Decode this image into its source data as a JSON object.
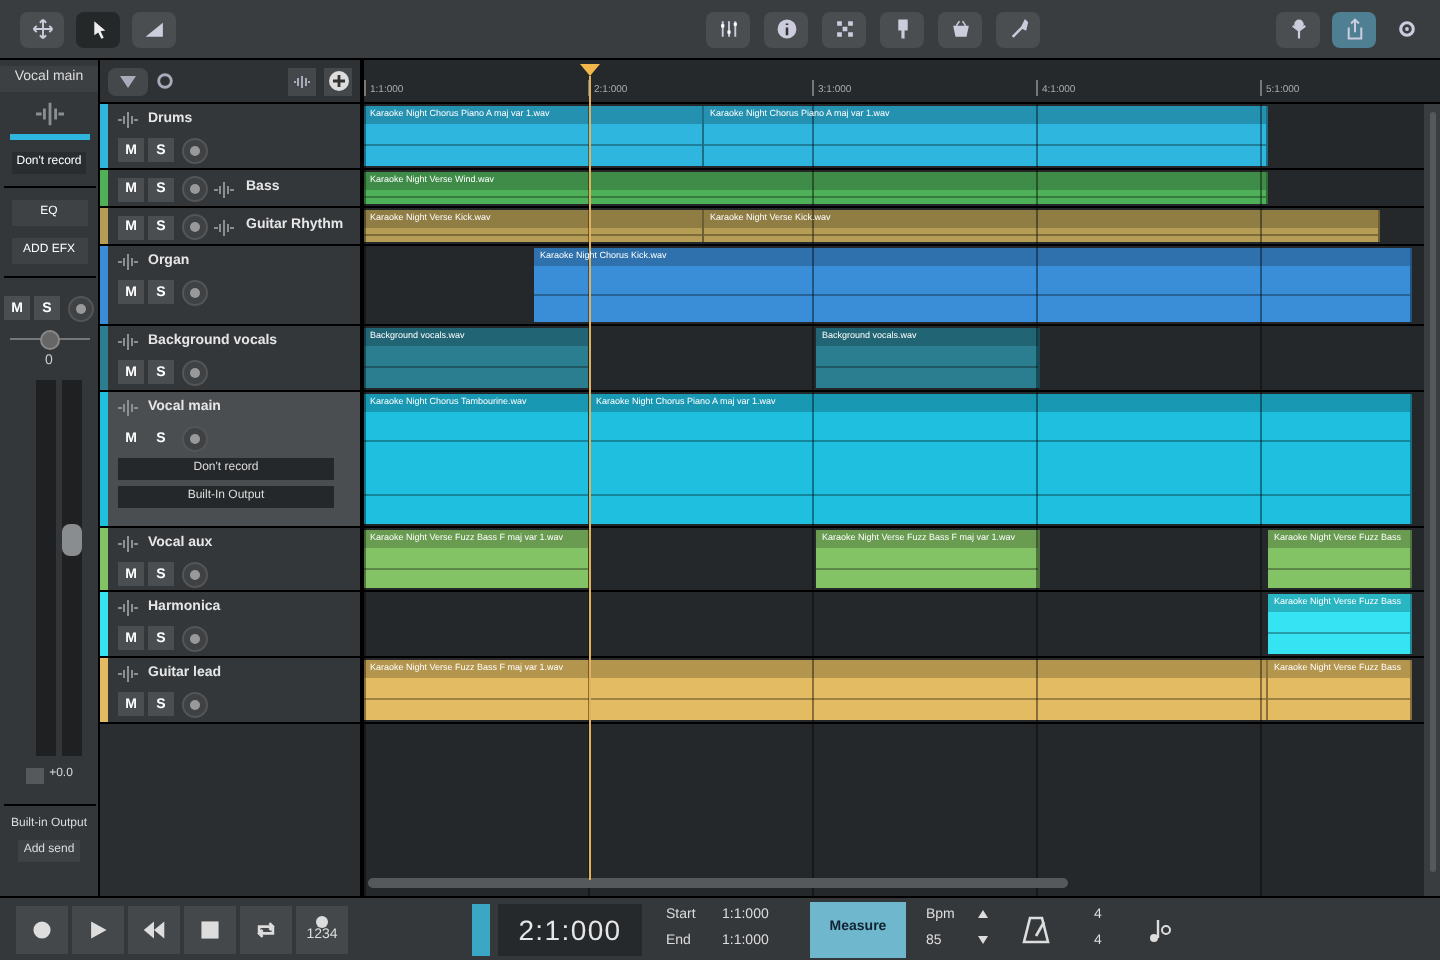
{
  "toolbar": {
    "left_tools": [
      {
        "kind": "move",
        "selected": false
      },
      {
        "kind": "pointer",
        "selected": true
      },
      {
        "kind": "ramp",
        "selected": false
      }
    ],
    "center_tools": [
      {
        "kind": "mixer"
      },
      {
        "kind": "info"
      },
      {
        "kind": "grid"
      },
      {
        "kind": "plugin"
      },
      {
        "kind": "basket"
      },
      {
        "kind": "wrench"
      }
    ],
    "right_tools": [
      {
        "kind": "network",
        "selected": false
      },
      {
        "kind": "share",
        "selected": true
      },
      {
        "kind": "settings",
        "selected": false
      }
    ]
  },
  "mixer": {
    "track_name": "Vocal main",
    "record": "Don't record",
    "eq": "EQ",
    "add_effects": "ADD EFX",
    "mute": "M",
    "solo": "S",
    "pan": {
      "level": 0.5,
      "reading": "0"
    },
    "level": 0.58,
    "gain": "+0.0",
    "output": "Built-in Output",
    "send": "Add send"
  },
  "ruler": {
    "marks": [
      "1:1:000",
      "2:1:000",
      "3:1:000",
      "4:1:000",
      "5:1:000"
    ]
  },
  "tracks": [
    {
      "name": "Drums",
      "color": "#2fb6de",
      "kind": "standard",
      "selected": false,
      "mute": "M",
      "solo": "S",
      "clips": [
        {
          "name": "Karaoke Night Chorus Piano A maj var 1.wav"
        },
        {
          "name": "Karaoke Night Chorus Piano A maj var 1.wav"
        }
      ]
    },
    {
      "name": "Bass",
      "color": "#4fb05a",
      "kind": "inline",
      "selected": false,
      "mute": "M",
      "solo": "S",
      "clips": [
        {
          "name": "Karaoke Night Verse Wind.wav"
        }
      ]
    },
    {
      "name": "Guitar Rhythm",
      "color": "#b59d55",
      "kind": "inline",
      "selected": false,
      "mute": "M",
      "solo": "S",
      "clips": [
        {
          "name": "Karaoke Night Verse Kick.wav"
        },
        {
          "name": "Karaoke Night Verse Kick.wav"
        }
      ]
    },
    {
      "name": "Organ",
      "color": "#3a8ed8",
      "kind": "standard",
      "selected": false,
      "mute": "M",
      "solo": "S",
      "clips": [
        {
          "name": "Karaoke Night Chorus Kick.wav"
        }
      ]
    },
    {
      "name": "Background vocals",
      "color": "#2a7e90",
      "kind": "standard",
      "selected": false,
      "mute": "M",
      "solo": "S",
      "clips": [
        {
          "name": "Background vocals.wav"
        },
        {
          "name": "Background vocals.wav"
        }
      ]
    },
    {
      "name": "Vocal main",
      "color": "#1fbfdf",
      "kind": "standard",
      "selected": true,
      "mute": "M",
      "solo": "S",
      "record": "Don't record",
      "output": "Built-In Output",
      "clips": [
        {
          "name": "Karaoke Night Chorus Tambourine.wav"
        },
        {
          "name": "Karaoke Night Chorus Piano A maj var 1.wav"
        }
      ]
    },
    {
      "name": "Vocal aux",
      "color": "#84c266",
      "kind": "standard",
      "selected": false,
      "mute": "M",
      "solo": "S",
      "clips": [
        {
          "name": "Karaoke Night Verse Fuzz Bass F maj var 1.wav"
        },
        {
          "name": "Karaoke Night Verse Fuzz Bass F maj var 1.wav"
        },
        {
          "name": "Karaoke Night Verse Fuzz Bass"
        }
      ]
    },
    {
      "name": "Harmonica",
      "color": "#35e3f3",
      "kind": "standard",
      "selected": false,
      "mute": "M",
      "solo": "S",
      "clips": [
        {
          "name": "Karaoke Night Verse Fuzz Bass"
        }
      ]
    },
    {
      "name": "Guitar lead",
      "color": "#e2bb62",
      "kind": "standard",
      "selected": false,
      "mute": "M",
      "solo": "S",
      "clips": [
        {
          "name": "Karaoke Night Verse Fuzz Bass F maj var 1.wav"
        },
        {
          "name": "Karaoke Night Verse Fuzz Bass"
        }
      ]
    }
  ],
  "transport": {
    "buttons": [
      {
        "kind": "record"
      },
      {
        "kind": "play"
      },
      {
        "kind": "rewind"
      },
      {
        "kind": "stop"
      },
      {
        "kind": "loop"
      }
    ],
    "count_in": "1234",
    "monitor_on": true,
    "position": "2:1:000",
    "start_label": "Start",
    "start": "1:1:000",
    "end_label": "End",
    "end": "1:1:000",
    "measure": {
      "label": "Measure",
      "selected": true
    },
    "bpm_label": "Bpm",
    "bpm": "85",
    "time_signature": [
      "4",
      "4"
    ]
  }
}
